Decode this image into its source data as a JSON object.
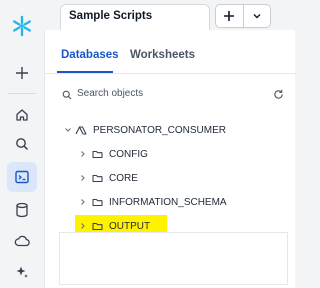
{
  "tab": {
    "title": "Sample Scripts"
  },
  "buttons": {
    "add": "+",
    "more": "⌄"
  },
  "segments": {
    "databases": "Databases",
    "worksheets": "Worksheets"
  },
  "search": {
    "placeholder": "Search objects"
  },
  "tree": {
    "root": "PERSONATOR_CONSUMER",
    "schemas": [
      {
        "label": "CONFIG"
      },
      {
        "label": "CORE"
      },
      {
        "label": "INFORMATION_SCHEMA"
      },
      {
        "label": "OUTPUT",
        "highlighted": true
      }
    ]
  },
  "colors": {
    "accent": "#1a56c7",
    "highlight": "#fff200",
    "brand": "#29b5e8"
  },
  "icons": [
    "snowflake-logo-icon",
    "plus-icon",
    "home-icon",
    "search-icon",
    "worksheet-icon",
    "database-icon",
    "cloud-icon",
    "sparkle-icon",
    "refresh-icon",
    "chevron-down-icon",
    "chevron-right-icon",
    "schema-icon",
    "database-tree-icon"
  ]
}
